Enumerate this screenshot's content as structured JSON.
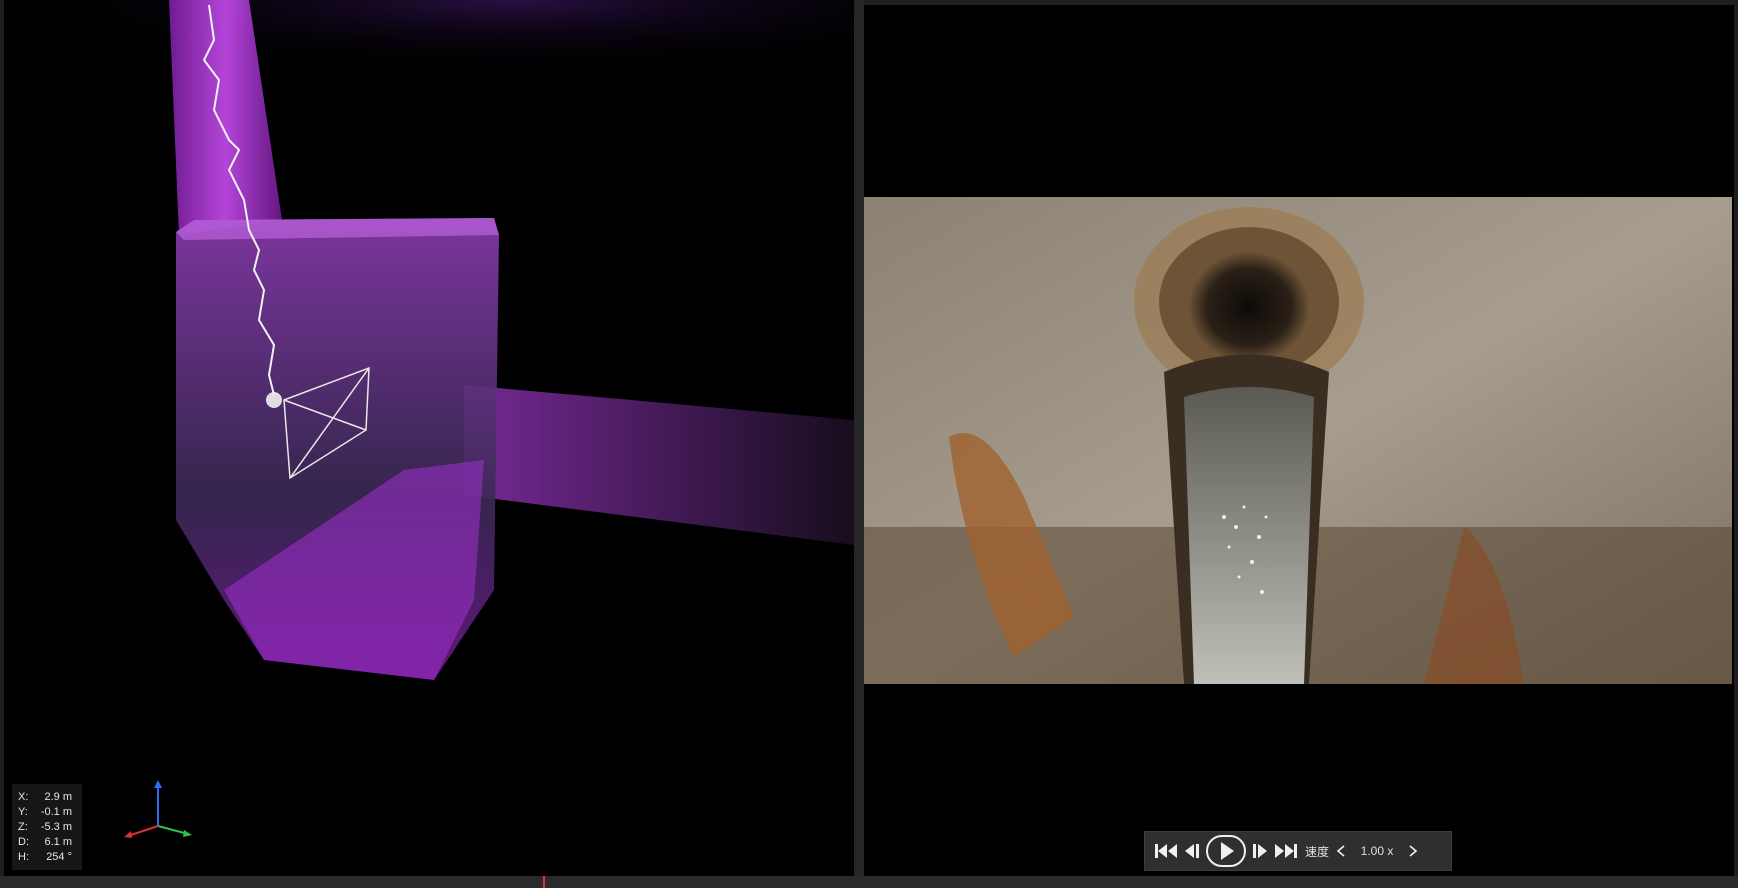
{
  "viewer3d": {
    "coordinates": [
      {
        "key": "X:",
        "value": "2.9 m"
      },
      {
        "key": "Y:",
        "value": "-0.1 m"
      },
      {
        "key": "Z:",
        "value": "-5.3 m"
      },
      {
        "key": "D:",
        "value": "6.1 m"
      },
      {
        "key": "H:",
        "value": "254 °"
      }
    ],
    "point_cloud_color": "#c23cf0"
  },
  "player": {
    "speed_label": "速度",
    "speed_value": "1.00 x",
    "icons": {
      "skip_start": "skip-to-start-icon",
      "step_back": "step-back-icon",
      "play": "play-icon",
      "step_forward": "step-forward-icon",
      "skip_end": "skip-to-end-icon",
      "speed_decrease": "chevron-left-icon",
      "speed_increase": "chevron-right-icon"
    }
  },
  "timeline": {
    "marker_color": "#e0342f"
  }
}
